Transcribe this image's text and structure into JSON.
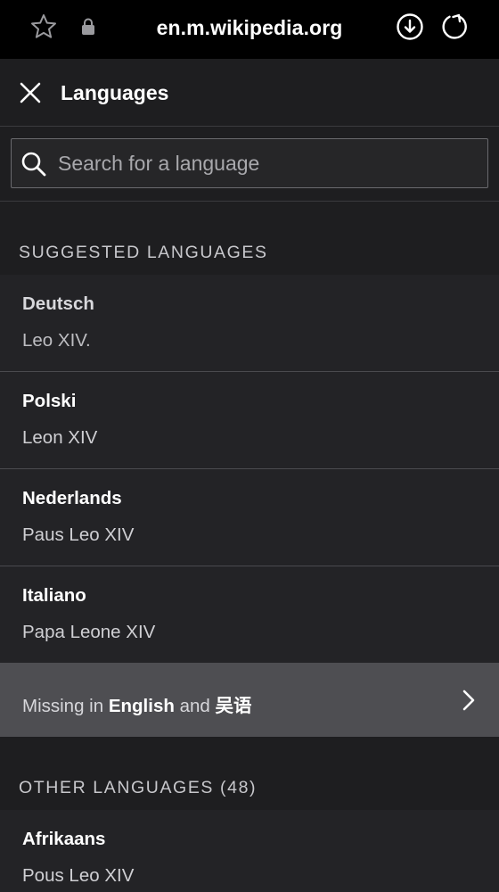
{
  "browser": {
    "url": "en.m.wikipedia.org",
    "icons": [
      "star-icon",
      "lock-icon",
      "download-icon",
      "refresh-icon"
    ]
  },
  "header": {
    "title": "Languages",
    "close_icon": "close-icon"
  },
  "search": {
    "placeholder": "Search for a language",
    "value": "",
    "icon": "search-icon"
  },
  "suggested": {
    "heading": "SUGGESTED LANGUAGES",
    "items": [
      {
        "language": "Deutsch",
        "title": "Leo XIV."
      },
      {
        "language": "Polski",
        "title": "Leon XIV"
      },
      {
        "language": "Nederlands",
        "title": "Paus Leo XIV"
      },
      {
        "language": "Italiano",
        "title": "Papa Leone XIV"
      }
    ]
  },
  "missing": {
    "prefix": "Missing in ",
    "lang1": "English",
    "conj": " and ",
    "lang2": "吴语",
    "icon": "chevron-right-icon"
  },
  "other": {
    "heading": "OTHER LANGUAGES (48)",
    "items": [
      {
        "language": "Afrikaans",
        "title": "Pous Leo XIV"
      }
    ]
  },
  "colors": {
    "background": "#1e1e20",
    "row": "#232326",
    "banner": "#4e4e52",
    "browser_bar": "#000000"
  }
}
